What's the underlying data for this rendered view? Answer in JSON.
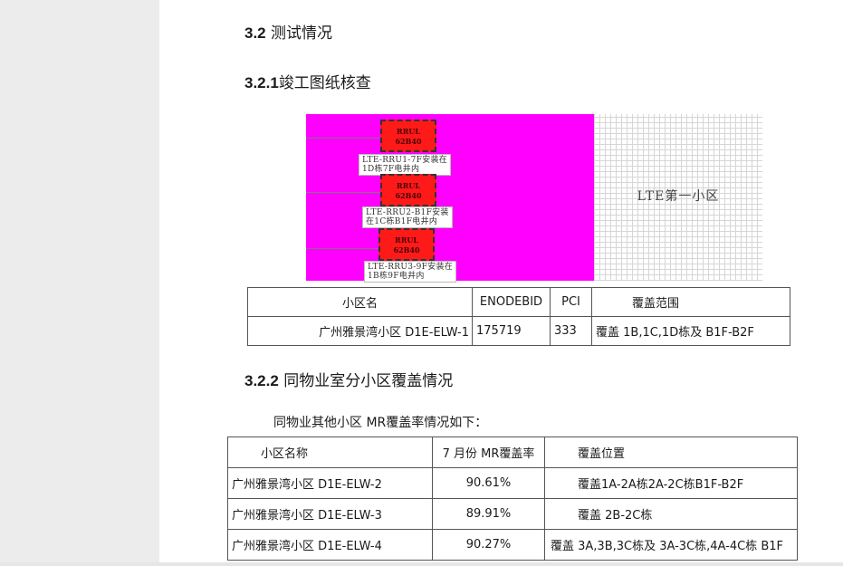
{
  "section": {
    "number": "3.2",
    "title": " 测试情况"
  },
  "sub1": {
    "number": "3.2.1",
    "title": "竣工图纸核查"
  },
  "figure": {
    "rrus": [
      {
        "name": "RRUL\n62B40",
        "note": "LTE-RRU1-7F安装在\n1D栋7F电井内"
      },
      {
        "name": "RRUL\n62B40",
        "note": "LTE-RRU2-B1F安装\n在1C栋B1F电井内"
      },
      {
        "name": "RRUL\n62B40",
        "note": "LTE-RRU3-9F安装在\n1B栋9F电井内"
      }
    ],
    "cell_label": "LTE第一小区",
    "colors": {
      "background": "#ff00ff",
      "rru": "#ff1a1a"
    }
  },
  "table1": {
    "headers": [
      "小区名",
      "ENODEBID",
      "PCI",
      "覆盖范围"
    ],
    "rows": [
      [
        "广州雅景湾小区 D1E-ELW-1",
        "175719",
        "333",
        "覆盖 1B,1C,1D栋及 B1F-B2F"
      ]
    ]
  },
  "sub2": {
    "number": "3.2.2",
    "title": " 同物业室分小区覆盖情况"
  },
  "intro": "同物业其他小区 MR覆盖率情况如下：",
  "table2": {
    "headers": [
      "小区名称",
      "7 月份 MR覆盖率",
      "覆盖位置"
    ],
    "rows": [
      [
        "广州雅景湾小区 D1E-ELW-2",
        "90.61%",
        "覆盖1A-2A栋2A-2C栋B1F-B2F"
      ],
      [
        "广州雅景湾小区 D1E-ELW-3",
        "89.91%",
        "覆盖 2B-2C栋"
      ],
      [
        "广州雅景湾小区 D1E-ELW-4",
        "90.27%",
        "覆盖 3A,3B,3C栋及 3A-3C栋,4A-4C栋 B1F"
      ]
    ]
  }
}
